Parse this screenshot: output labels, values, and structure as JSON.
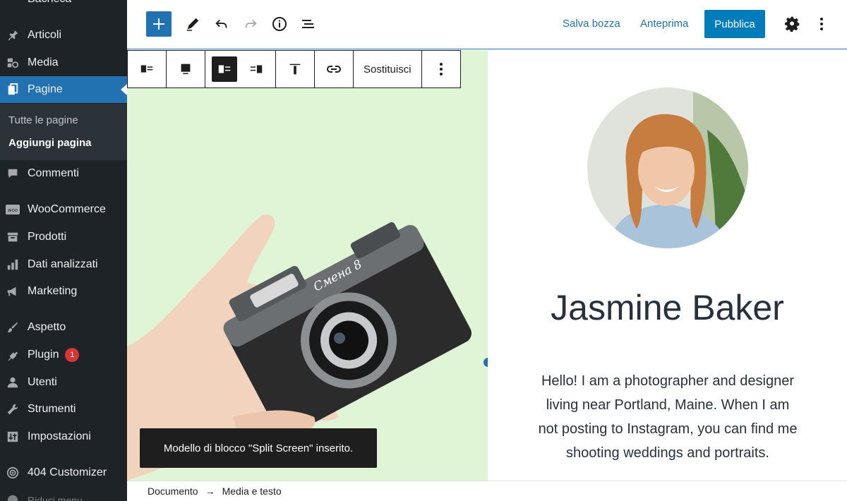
{
  "sidebar": {
    "top_partial_label": "Bacheca",
    "items": [
      {
        "label": "Articoli",
        "icon": "pin-icon"
      },
      {
        "label": "Media",
        "icon": "media-icon"
      },
      {
        "label": "Pagine",
        "icon": "pages-icon"
      },
      {
        "label": "Commenti",
        "icon": "comment-icon"
      },
      {
        "label": "WooCommerce",
        "icon": "woo-icon"
      },
      {
        "label": "Prodotti",
        "icon": "archive-icon"
      },
      {
        "label": "Dati analizzati",
        "icon": "bar-chart-icon"
      },
      {
        "label": "Marketing",
        "icon": "megaphone-icon"
      },
      {
        "label": "Aspetto",
        "icon": "brush-icon"
      },
      {
        "label": "Plugin",
        "icon": "plug-icon",
        "badge": "1"
      },
      {
        "label": "Utenti",
        "icon": "user-icon"
      },
      {
        "label": "Strumenti",
        "icon": "wrench-icon"
      },
      {
        "label": "Impostazioni",
        "icon": "sliders-icon"
      },
      {
        "label": "404 Customizer",
        "icon": "wifi-icon"
      }
    ],
    "submenu": [
      "Tutte le pagine",
      "Aggiungi pagina"
    ],
    "collapse_label": "Riduci menu"
  },
  "topbar": {
    "save_draft": "Salva bozza",
    "preview": "Anteprima",
    "publish": "Pubblica"
  },
  "block_toolbar": {
    "replace": "Sostituisci"
  },
  "content": {
    "name": "Jasmine Baker",
    "bio": "Hello! I am a photographer and designer living near Portland, Maine. When I am not posting to Instagram, you can find me shooting weddings and portraits.",
    "camera_brand": "Смена 8"
  },
  "notice": "Modello di blocco \"Split Screen\" inserito.",
  "breadcrumb": {
    "root": "Documento",
    "current": "Media e testo"
  },
  "colors": {
    "sidebar_bg": "#1d2327",
    "accent": "#2271b1",
    "media_bg": "#dff5d6",
    "badge": "#d63638"
  }
}
